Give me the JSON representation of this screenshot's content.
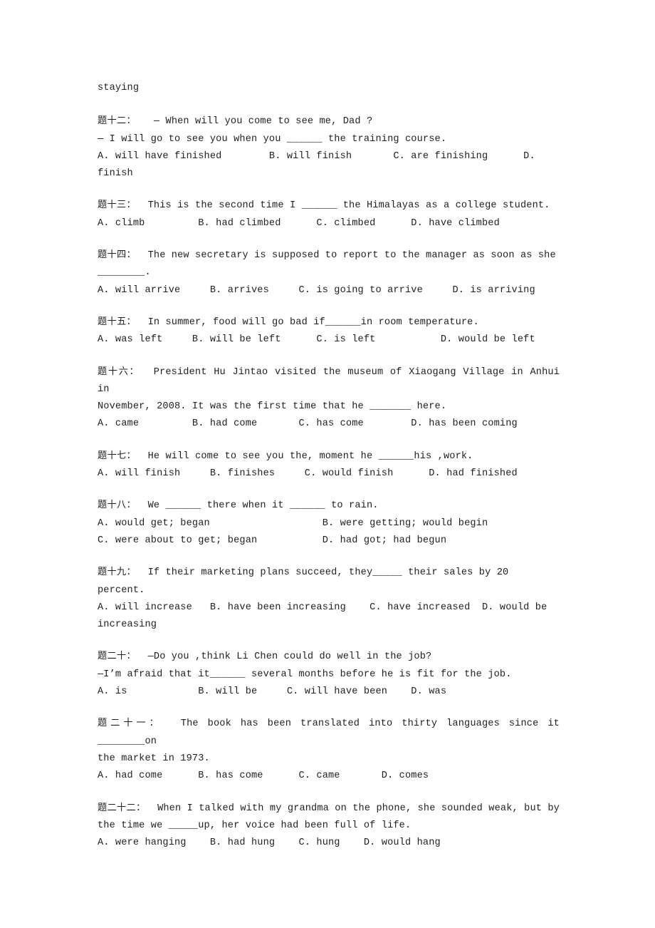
{
  "document": {
    "type": "english-grammar-worksheet",
    "language": "zh-CN + en",
    "page_background": "#ffffff",
    "text_color": "#1f1f1f",
    "highlight_color": "#b5b500"
  },
  "intro": {
    "orphan_word": "staying"
  },
  "questions": [
    {
      "id": "q12",
      "number": "题十二：",
      "stem_lines": [
        "— When will you come to see me, Dad ?",
        "— I will go to see you when you ______ the training course."
      ],
      "options_lines": [
        "A. will have finished        B. will finish       C. are finishing      D. finish"
      ]
    },
    {
      "id": "q13",
      "number": "题十三：",
      "stem_lines": [
        "This is the second time I ______ the Himalayas as a college student."
      ],
      "options_lines": [
        "A. climb         B. had climbed      C. climbed      D. have climbed"
      ]
    },
    {
      "id": "q14",
      "number": "题十四：",
      "stem_lines": [
        "The new secretary is supposed to report to the manager as soon as she",
        "________."
      ],
      "options_lines": [
        "A. will arrive     B. arrives     C. is going to arrive     D. is arriving"
      ]
    },
    {
      "id": "q15",
      "number": "题十五：",
      "stem_lines": [
        "In summer, food will go bad if______in room temperature."
      ],
      "options_lines": [
        "A. was left     B. will be left      C. is left           D. would be left"
      ]
    },
    {
      "id": "q16",
      "number": "题十六：",
      "stem_lines": [
        "President Hu Jintao visited the museum of Xiaogang Village in Anhui in",
        "November, 2008. It was the first time that he _______ here."
      ],
      "options_lines": [
        "A. came         B. had come       C. has come        D. has been coming"
      ]
    },
    {
      "id": "q17",
      "number": "题十七：",
      "stem_lines": [
        "He will come to see you the, moment he ______his ,work."
      ],
      "options_lines": [
        "A. will finish     B. finishes     C. would finish      D. had finished"
      ],
      "has_highlight_marks": true
    },
    {
      "id": "q18",
      "number": "题十八：",
      "stem_lines": [
        "We ______ there when it ______ to rain."
      ],
      "options_lines": [
        "A. would get; began                   B. were getting; would begin",
        "C. were about to get; began           D. had got; had begun"
      ]
    },
    {
      "id": "q19",
      "number": "题十九：",
      "stem_lines": [
        "If their marketing plans succeed, they_____ their sales by 20",
        "percent."
      ],
      "options_lines": [
        "A. will increase   B. have been increasing    C. have increased  D. would be",
        "increasing"
      ]
    },
    {
      "id": "q20",
      "number": "题二十：",
      "stem_lines": [
        "—Do you ,think Li Chen could do well in the job?",
        "—I’m afraid that it______ several months before he is fit for the job."
      ],
      "options_lines": [
        "A. is            B. will be     C. will have been    D. was"
      ],
      "has_highlight_marks": true
    },
    {
      "id": "q21",
      "number": "题二十一：",
      "stem_lines": [
        "The book has been translated into thirty languages since it ________on",
        "the market in 1973."
      ],
      "options_lines": [
        "A. had come      B. has come      C. came       D. comes"
      ]
    },
    {
      "id": "q22",
      "number": "题二十二：",
      "stem_lines": [
        "When I talked with my grandma on the phone, she sounded weak, but by",
        "the time we _____up, her voice had been full of life."
      ],
      "options_lines": [
        "A. were hanging    B. had hung    C. hung    D. would hang"
      ]
    }
  ]
}
